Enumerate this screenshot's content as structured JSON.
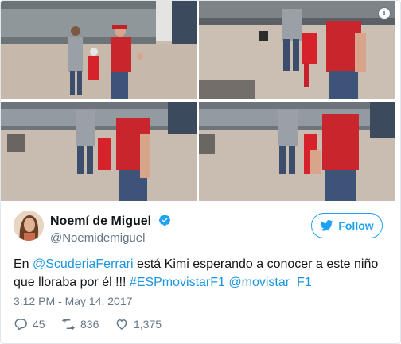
{
  "tweet": {
    "author_name": "Noemí de Miguel",
    "author_handle": "@Noemidemiguel",
    "follow_label": "Follow",
    "text_prefix": "En ",
    "mention_1": "@ScuderiaFerrari",
    "text_middle": " está Kimi esperando a conocer a este niño que lloraba por él !!! ",
    "hashtag": "#ESPmovistarF1",
    "text_space": " ",
    "mention_2": "@movistar_F1",
    "timestamp": "3:12 PM - May 14, 2017",
    "replies": "45",
    "retweets": "836",
    "likes": "1,375"
  },
  "icons": {
    "info": "info-icon",
    "verified": "verified-badge-icon",
    "twitter_bird": "twitter-bird-icon",
    "reply": "reply-icon",
    "retweet": "retweet-icon",
    "like": "heart-icon"
  },
  "colors": {
    "link": "#1b95e0",
    "follow": "#1da1f2",
    "muted": "#657786"
  },
  "labels": {
    "info_glyph": "i"
  }
}
